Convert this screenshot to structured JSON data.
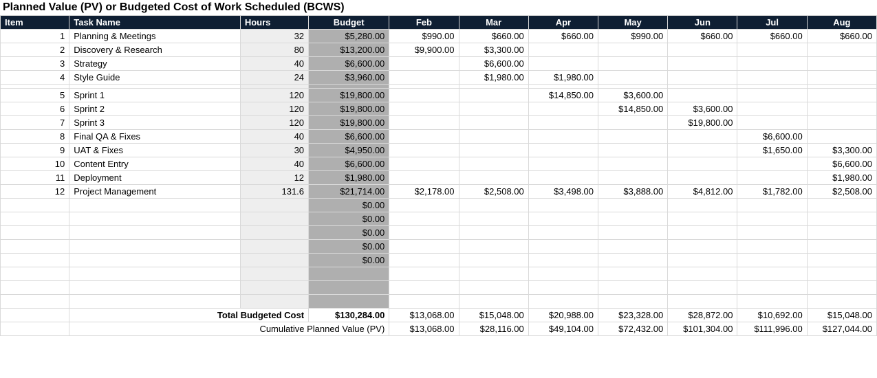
{
  "title": "Planned Value (PV) or Budgeted Cost of Work Scheduled (BCWS)",
  "headers": {
    "item": "Item",
    "task": "Task Name",
    "hours": "Hours",
    "budget": "Budget",
    "months": [
      "Feb",
      "Mar",
      "Apr",
      "May",
      "Jun",
      "Jul",
      "Aug"
    ]
  },
  "rows": [
    {
      "item": "1",
      "task": "Planning & Meetings",
      "hours": "32",
      "budget": "$5,280.00",
      "m": [
        "$990.00",
        "$660.00",
        "$660.00",
        "$990.00",
        "$660.00",
        "$660.00",
        "$660.00"
      ]
    },
    {
      "item": "2",
      "task": "Discovery & Research",
      "hours": "80",
      "budget": "$13,200.00",
      "m": [
        "$9,900.00",
        "$3,300.00",
        "",
        "",
        "",
        "",
        ""
      ]
    },
    {
      "item": "3",
      "task": "Strategy",
      "hours": "40",
      "budget": "$6,600.00",
      "m": [
        "",
        "$6,600.00",
        "",
        "",
        "",
        "",
        ""
      ]
    },
    {
      "item": "4",
      "task": "Style Guide",
      "hours": "24",
      "budget": "$3,960.00",
      "m": [
        "",
        "$1,980.00",
        "$1,980.00",
        "",
        "",
        "",
        ""
      ]
    },
    {
      "gap": true
    },
    {
      "item": "5",
      "task": "Sprint 1",
      "hours": "120",
      "budget": "$19,800.00",
      "m": [
        "",
        "",
        "$14,850.00",
        "$3,600.00",
        "",
        "",
        ""
      ]
    },
    {
      "item": "6",
      "task": "Sprint 2",
      "hours": "120",
      "budget": "$19,800.00",
      "m": [
        "",
        "",
        "",
        "$14,850.00",
        "$3,600.00",
        "",
        ""
      ]
    },
    {
      "item": "7",
      "task": "Sprint 3",
      "hours": "120",
      "budget": "$19,800.00",
      "m": [
        "",
        "",
        "",
        "",
        "$19,800.00",
        "",
        ""
      ]
    },
    {
      "item": "8",
      "task": "Final QA & Fixes",
      "hours": "40",
      "budget": "$6,600.00",
      "m": [
        "",
        "",
        "",
        "",
        "",
        "$6,600.00",
        ""
      ]
    },
    {
      "item": "9",
      "task": "UAT & Fixes",
      "hours": "30",
      "budget": "$4,950.00",
      "m": [
        "",
        "",
        "",
        "",
        "",
        "$1,650.00",
        "$3,300.00"
      ]
    },
    {
      "item": "10",
      "task": "Content Entry",
      "hours": "40",
      "budget": "$6,600.00",
      "m": [
        "",
        "",
        "",
        "",
        "",
        "",
        "$6,600.00"
      ]
    },
    {
      "item": "11",
      "task": "Deployment",
      "hours": "12",
      "budget": "$1,980.00",
      "m": [
        "",
        "",
        "",
        "",
        "",
        "",
        "$1,980.00"
      ]
    },
    {
      "item": "12",
      "task": "Project Management",
      "hours": "131.6",
      "budget": "$21,714.00",
      "m": [
        "$2,178.00",
        "$2,508.00",
        "$3,498.00",
        "$3,888.00",
        "$4,812.00",
        "$1,782.00",
        "$2,508.00"
      ]
    },
    {
      "item": "",
      "task": "",
      "hours": "",
      "budget": "$0.00",
      "m": [
        "",
        "",
        "",
        "",
        "",
        "",
        ""
      ]
    },
    {
      "item": "",
      "task": "",
      "hours": "",
      "budget": "$0.00",
      "m": [
        "",
        "",
        "",
        "",
        "",
        "",
        ""
      ]
    },
    {
      "item": "",
      "task": "",
      "hours": "",
      "budget": "$0.00",
      "m": [
        "",
        "",
        "",
        "",
        "",
        "",
        ""
      ]
    },
    {
      "item": "",
      "task": "",
      "hours": "",
      "budget": "$0.00",
      "m": [
        "",
        "",
        "",
        "",
        "",
        "",
        ""
      ]
    },
    {
      "item": "",
      "task": "",
      "hours": "",
      "budget": "$0.00",
      "m": [
        "",
        "",
        "",
        "",
        "",
        "",
        ""
      ]
    },
    {
      "item": "",
      "task": "",
      "hours": "",
      "budget": "",
      "m": [
        "",
        "",
        "",
        "",
        "",
        "",
        ""
      ]
    },
    {
      "item": "",
      "task": "",
      "hours": "",
      "budget": "",
      "m": [
        "",
        "",
        "",
        "",
        "",
        "",
        ""
      ]
    },
    {
      "item": "",
      "task": "",
      "hours": "",
      "budget": "",
      "m": [
        "",
        "",
        "",
        "",
        "",
        "",
        ""
      ]
    }
  ],
  "totals": {
    "label": "Total Budgeted Cost",
    "budget": "$130,284.00",
    "months": [
      "$13,068.00",
      "$15,048.00",
      "$20,988.00",
      "$23,328.00",
      "$28,872.00",
      "$10,692.00",
      "$15,048.00"
    ]
  },
  "cumulative": {
    "label": "Cumulative Planned Value (PV)",
    "months": [
      "$13,068.00",
      "$28,116.00",
      "$49,104.00",
      "$72,432.00",
      "$101,304.00",
      "$111,996.00",
      "$127,044.00"
    ]
  }
}
